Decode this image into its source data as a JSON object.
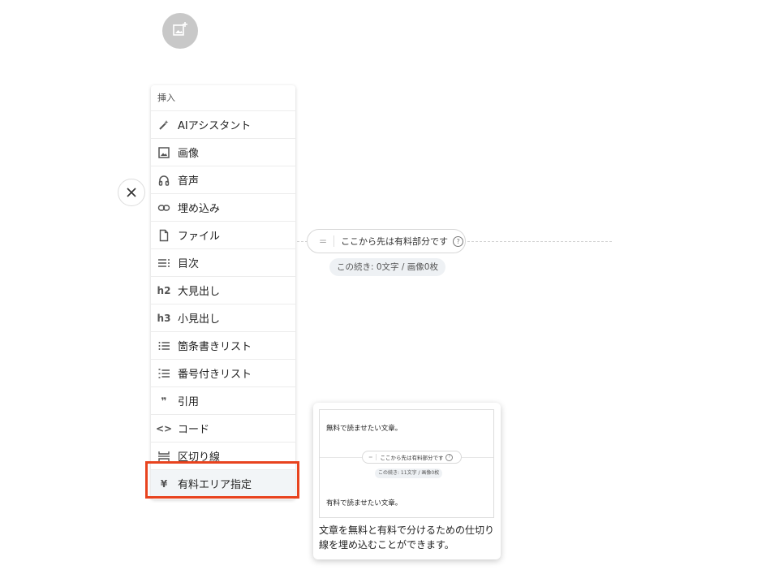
{
  "menu": {
    "header": "挿入",
    "items": [
      {
        "label": "AIアシスタント",
        "icon": "magic-wand-icon"
      },
      {
        "label": "画像",
        "icon": "image-icon"
      },
      {
        "label": "音声",
        "icon": "headphones-icon"
      },
      {
        "label": "埋め込み",
        "icon": "link-icon"
      },
      {
        "label": "ファイル",
        "icon": "file-icon"
      },
      {
        "label": "目次",
        "icon": "toc-icon"
      },
      {
        "label": "大見出し",
        "icon": "h2-icon",
        "icon_text": "h2"
      },
      {
        "label": "小見出し",
        "icon": "h3-icon",
        "icon_text": "h3"
      },
      {
        "label": "箇条書きリスト",
        "icon": "bullet-list-icon"
      },
      {
        "label": "番号付きリスト",
        "icon": "numbered-list-icon"
      },
      {
        "label": "引用",
        "icon": "quote-icon",
        "icon_text": "❞"
      },
      {
        "label": "コード",
        "icon": "code-icon",
        "icon_text": "<>"
      },
      {
        "label": "区切り線",
        "icon": "divider-icon"
      },
      {
        "label": "有料エリア指定",
        "icon": "yen-icon",
        "icon_text": "¥",
        "highlighted": true
      }
    ]
  },
  "paid_divider": {
    "label": "ここから先は有料部分です",
    "handle": "=",
    "help": "?",
    "remaining": "この続き: 0文字 / 画像0枚"
  },
  "tooltip": {
    "preview": {
      "free_text": "無料で読ませたい文章。",
      "divider_label": "ここから先は有料部分です",
      "remaining": "この続き: 11文字 / 画像0枚",
      "paid_text": "有料で読ませたい文章。"
    },
    "description": "文章を無料と有料で分けるための仕切り線を埋め込むことができます。"
  },
  "colors": {
    "highlight_outline": "#e8431e",
    "add_image_button": "#c8c8c8"
  }
}
